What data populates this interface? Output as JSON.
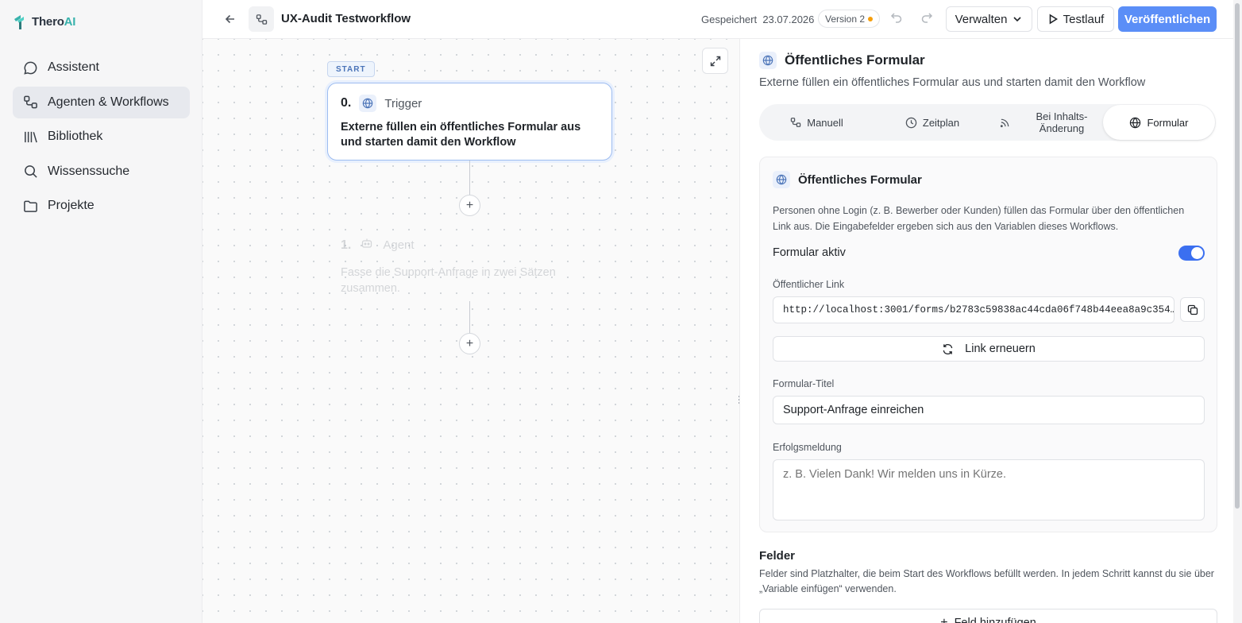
{
  "app": {
    "logo_main": "Thero",
    "logo_accent": "AI"
  },
  "sidebar": {
    "items": [
      {
        "label": "Assistent",
        "icon": "chat-bubble-icon"
      },
      {
        "label": "Agenten & Workflows",
        "icon": "workflow-icon",
        "active": true
      },
      {
        "label": "Bibliothek",
        "icon": "library-icon"
      },
      {
        "label": "Wissenssuche",
        "icon": "search-icon"
      },
      {
        "label": "Projekte",
        "icon": "folder-icon"
      }
    ]
  },
  "topbar": {
    "title": "UX-Audit Testworkflow",
    "saved_label": "Gespeichert",
    "saved_date": "23.07.2026",
    "version": "Version 2",
    "manage_label": "Verwalten",
    "test_label": "Testlauf",
    "publish_label": "Veröffentlichen"
  },
  "canvas": {
    "start_badge": "START",
    "trigger_node": {
      "number": "0.",
      "type": "Trigger",
      "description": "Externe füllen ein öffentliches Formular aus und starten damit den Workflow"
    },
    "agent_node": {
      "number": "1.",
      "type": "Agent",
      "description": "Fasse die Support-Anfrage in zwei Sätzen zusammen."
    },
    "plus_symbol": "+"
  },
  "panel": {
    "title": "Öffentliches Formular",
    "subtitle": "Externe füllen ein öffentliches Formular aus und starten damit den Workflow",
    "tabs": [
      {
        "label": "Manuell",
        "icon": "workflow-icon"
      },
      {
        "label": "Zeitplan",
        "icon": "clock-icon"
      },
      {
        "label": "Bei Inhalts-Änderung",
        "icon": "rss-icon"
      },
      {
        "label": "Formular",
        "icon": "globe-icon",
        "selected": true
      }
    ],
    "card": {
      "title": "Öffentliches Formular",
      "description": "Personen ohne Login (z. B. Bewerber oder Kunden) füllen das Formular über den öffentlichen Link aus. Die Eingabefelder ergeben sich aus den Variablen dieses Workflows.",
      "active_label": "Formular aktiv",
      "active": true,
      "link_label": "Öffentlicher Link",
      "link_value": "http://localhost:3001/forms/b2783c59838ac44cda06f748b44eea8a9c354…",
      "renew_label": "Link erneuern",
      "form_title_label": "Formular-Titel",
      "form_title_value": "Support-Anfrage einreichen",
      "success_label": "Erfolgsmeldung",
      "success_placeholder": "z. B. Vielen Dank! Wir melden uns in Kürze."
    },
    "fields": {
      "title": "Felder",
      "description": "Felder sind Platzhalter, die beim Start des Workflows befüllt werden. In jedem Schritt kannst du sie über „Variable einfügen“ verwenden.",
      "add_label": "Feld hinzufügen"
    }
  },
  "colors": {
    "accent": "#5b8ef7",
    "toggle": "#3b6ff0",
    "version_dot": "#f59e0b",
    "logo_accent": "#38b2ac"
  }
}
